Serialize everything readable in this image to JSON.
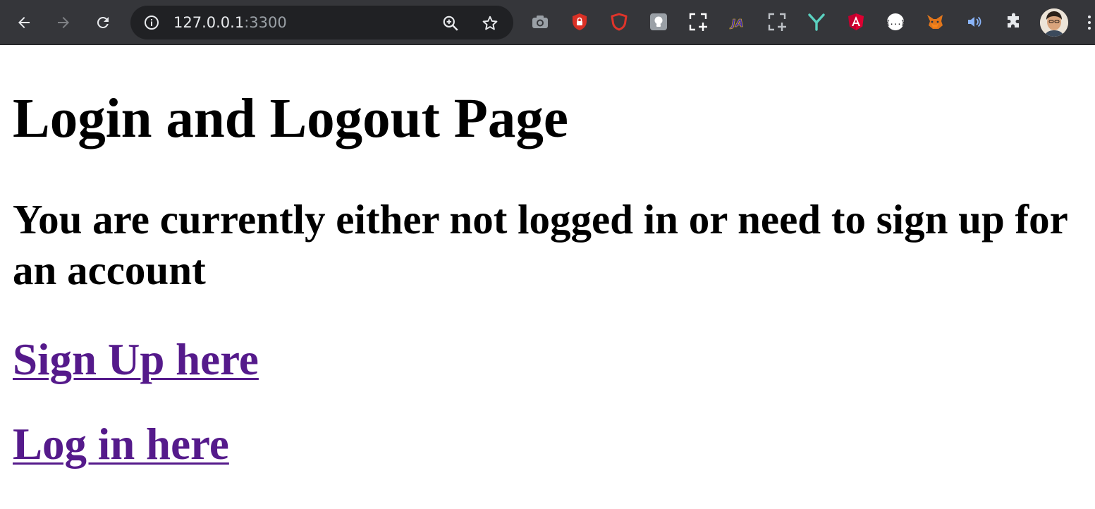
{
  "browser": {
    "url_host": "127.0.0.1",
    "url_port": ":3300",
    "icons": {
      "back": "back-arrow-icon",
      "forward": "forward-arrow-icon",
      "reload": "reload-icon",
      "site_info": "info-icon",
      "zoom": "zoom-in-icon",
      "bookmark": "star-icon"
    },
    "extensions": [
      "camera-icon",
      "lock-shield-icon",
      "brave-shield-icon",
      "lightbulb-icon",
      "screenshot-crop-icon",
      "ja-icon",
      "selection-crop-icon",
      "y-logo-icon",
      "angular-icon",
      "json-viewer-icon",
      "metamask-fox-icon",
      "speaker-icon",
      "puzzle-extensions-icon"
    ],
    "colors": {
      "toolbar": "#35363a",
      "omnibox": "#202124",
      "url_text": "#e8eaed",
      "url_port": "#9aa0a6"
    }
  },
  "page": {
    "title": "Login and Logout Page",
    "message": "You are currently either not logged in or need to sign up for an account",
    "links": {
      "signup": "Sign Up here",
      "login": "Log in here"
    },
    "colors": {
      "text": "#000000",
      "visited_link": "#551a8b"
    }
  }
}
